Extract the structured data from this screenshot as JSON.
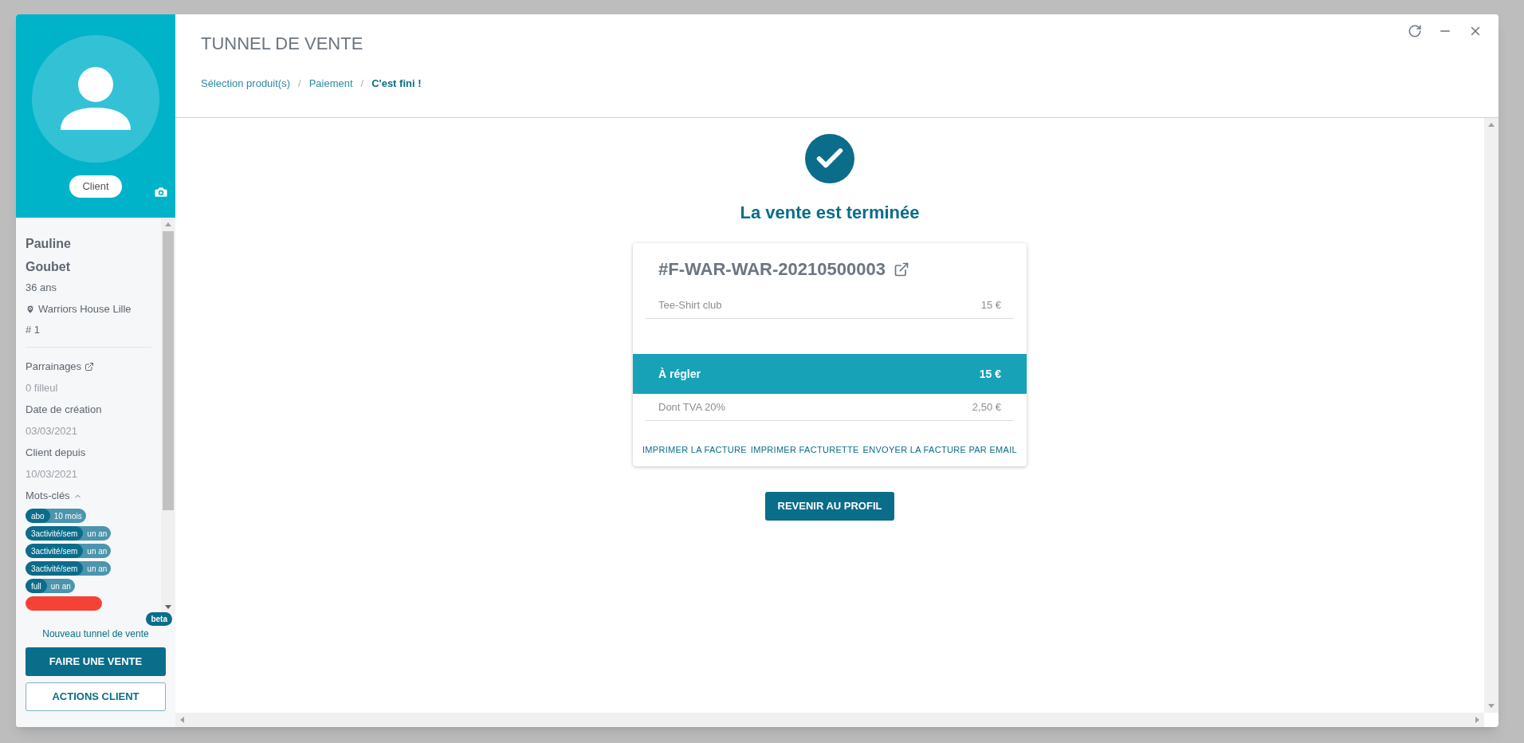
{
  "profile": {
    "badge": "Client",
    "first_name": "Pauline",
    "last_name": "Goubet",
    "age": "36 ans",
    "location": "Warriors House Lille",
    "number": "# 1"
  },
  "details": [
    {
      "kind": "link",
      "label": "Parrainages",
      "value": "0 filleul"
    },
    {
      "kind": "plain",
      "label": "Date de création",
      "value": "03/03/2021"
    },
    {
      "kind": "plain",
      "label": "Client depuis",
      "value": "10/03/2021"
    }
  ],
  "keywords": {
    "label": "Mots-clés",
    "expanded": true,
    "tags": [
      {
        "label": "abo",
        "value": "10 mois",
        "color": "#0a6d8a"
      },
      {
        "label": "3activité/sem",
        "value": "un an",
        "color": "#0a6d8a"
      },
      {
        "label": "3activité/sem",
        "value": "un an",
        "color": "#0a6d8a"
      },
      {
        "label": "3activité/sem",
        "value": "un an",
        "color": "#0a6d8a"
      },
      {
        "label": "full",
        "value": "un an",
        "color": "#0a6d8a"
      },
      {
        "color": "#f44336"
      }
    ]
  },
  "promo": {
    "text": "Nouveau tunnel de vente",
    "badge": "beta"
  },
  "actions": [
    {
      "label": "FAIRE UNE VENTE",
      "primary": true
    },
    {
      "label": "ACTIONS CLIENT",
      "primary": false
    }
  ],
  "modal": {
    "title": "TUNNEL DE VENTE",
    "separator": "/",
    "breadcrumb": [
      {
        "label": "Sélection produit(s)",
        "selected": false
      },
      {
        "label": "Paiement",
        "selected": false
      },
      {
        "label": "C'est fini !",
        "selected": true
      }
    ]
  },
  "success": {
    "message": "La vente est terminée"
  },
  "invoice": {
    "number": "#F-WAR-WAR-20210500003",
    "lines": [
      {
        "kind": "item",
        "label": "Tee-Shirt club",
        "amount": "15 €"
      },
      {
        "kind": "total",
        "label": "À régler",
        "amount": "15 €"
      },
      {
        "kind": "tax",
        "label": "Dont TVA 20%",
        "amount": "2,50 €"
      }
    ],
    "actions": [
      "IMPRIMER LA FACTURE",
      "IMPRIMER FACTURETTE",
      "ENVOYER LA FACTURE PAR EMAIL"
    ]
  },
  "back_button": "REVENIR AU PROFIL"
}
